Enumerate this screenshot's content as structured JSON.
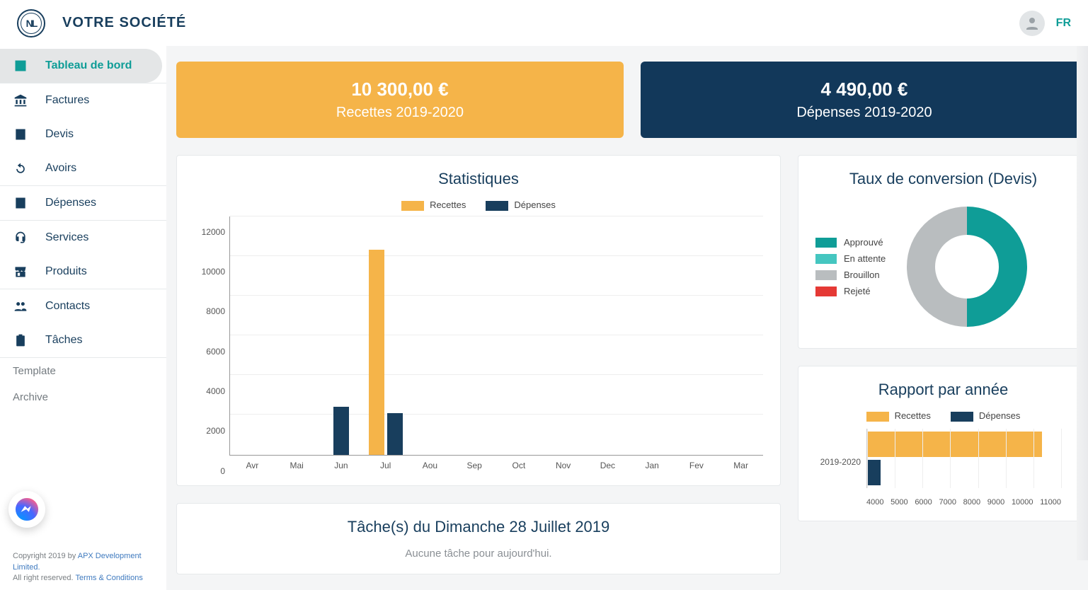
{
  "header": {
    "logo_text": "NL",
    "company": "VOTRE SOCIÉTÉ",
    "lang": "FR"
  },
  "sidebar": {
    "items": [
      {
        "label": "Tableau de bord",
        "icon": "dashboard",
        "active": true
      },
      {
        "label": "Factures",
        "icon": "bank"
      },
      {
        "label": "Devis",
        "icon": "list"
      },
      {
        "label": "Avoirs",
        "icon": "refresh"
      },
      {
        "label": "Dépenses",
        "icon": "list"
      },
      {
        "label": "Services",
        "icon": "headset"
      },
      {
        "label": "Produits",
        "icon": "store"
      },
      {
        "label": "Contacts",
        "icon": "people"
      },
      {
        "label": "Tâches",
        "icon": "clipboard"
      }
    ],
    "secondary": [
      {
        "label": "Template"
      },
      {
        "label": "Archive"
      }
    ],
    "footer_line1_prefix": "Copyright 2019 by ",
    "footer_line1_link": "APX Development Limited.",
    "footer_line2_prefix": "All right reserved. ",
    "footer_line2_link": "Terms & Conditions"
  },
  "kpi": {
    "revenue_amount": "10 300,00 €",
    "revenue_caption": "Recettes 2019-2020",
    "expense_amount": "4 490,00 €",
    "expense_caption": "Dépenses 2019-2020"
  },
  "stats": {
    "title": "Statistiques",
    "legend": {
      "revenue": "Recettes",
      "expense": "Dépenses"
    }
  },
  "chart_data": [
    {
      "id": "monthly_stats",
      "type": "bar",
      "title": "Statistiques",
      "xlabel": "",
      "ylabel": "",
      "ylim": [
        0,
        12000
      ],
      "yticks": [
        0,
        2000,
        4000,
        6000,
        8000,
        10000,
        12000
      ],
      "categories": [
        "Avr",
        "Mai",
        "Jun",
        "Jul",
        "Aou",
        "Sep",
        "Oct",
        "Nov",
        "Dec",
        "Jan",
        "Fev",
        "Mar"
      ],
      "series": [
        {
          "name": "Recettes",
          "color": "#f5b449",
          "values": [
            0,
            0,
            0,
            10300,
            0,
            0,
            0,
            0,
            0,
            0,
            0,
            0
          ]
        },
        {
          "name": "Dépenses",
          "color": "#183e5d",
          "values": [
            0,
            0,
            2400,
            2090,
            0,
            0,
            0,
            0,
            0,
            0,
            0,
            0
          ]
        }
      ]
    },
    {
      "id": "conversion_rate",
      "type": "pie",
      "title": "Taux de conversion  (Devis)",
      "series": [
        {
          "name": "Approuvé",
          "color": "#0f9d97",
          "value": 50
        },
        {
          "name": "En attente",
          "color": "#45c6c0",
          "value": 0
        },
        {
          "name": "Brouillon",
          "color": "#b9bdbf",
          "value": 50
        },
        {
          "name": "Rejeté",
          "color": "#e53935",
          "value": 0
        }
      ],
      "legend_labels": {
        "approved": "Approuvé",
        "pending": "En attente",
        "draft": "Brouillon",
        "rejected": "Rejeté"
      }
    },
    {
      "id": "annual_report",
      "type": "bar",
      "orientation": "horizontal",
      "title": "Rapport par année",
      "categories": [
        "2019-2020"
      ],
      "xlim": [
        4000,
        11000
      ],
      "xticks": [
        4000,
        5000,
        6000,
        7000,
        8000,
        9000,
        10000,
        11000
      ],
      "series": [
        {
          "name": "Recettes",
          "color": "#f5b449",
          "values": [
            10300
          ]
        },
        {
          "name": "Dépenses",
          "color": "#183e5d",
          "values": [
            4490
          ]
        }
      ],
      "legend": {
        "revenue": "Recettes",
        "expense": "Dépenses"
      }
    }
  ],
  "conversion": {
    "title": "Taux de conversion  (Devis)"
  },
  "annual": {
    "title": "Rapport par année"
  },
  "tasks": {
    "title": "Tâche(s) du  Dimanche 28 Juillet 2019",
    "empty_message": "Aucune tâche pour aujourd'hui."
  }
}
